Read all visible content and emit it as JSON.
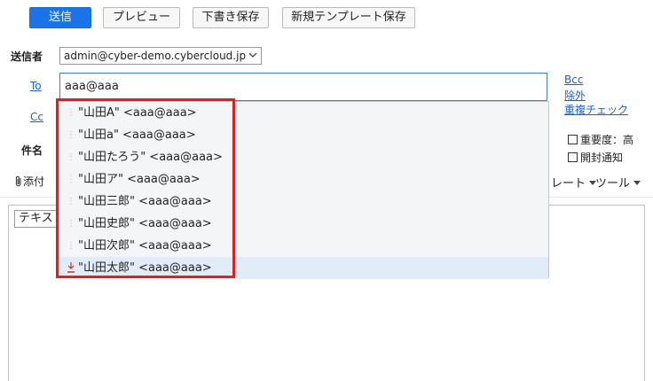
{
  "toolbar": {
    "send": "送信",
    "preview": "プレビュー",
    "save_draft": "下書き保存",
    "save_template": "新規テンプレート保存"
  },
  "sender": {
    "label": "送信者",
    "value": "admin@cyber-demo.cybercloud.jp"
  },
  "to": {
    "label": "To",
    "value": "aaa@aaa"
  },
  "cc": {
    "label": "Cc"
  },
  "subject": {
    "label": "件名"
  },
  "side_links": {
    "bcc": "Bcc",
    "exclude": "除外",
    "dup_check": "重複チェック"
  },
  "options": {
    "importance": "重要度：高",
    "read_receipt": "開封通知"
  },
  "attach": {
    "label": "添付"
  },
  "editor_toolbar": {
    "template_partial": "レート",
    "tools": "ツール",
    "format_partial": "テキス"
  },
  "suggestions": [
    "\"山田A\" <aaa@aaa>",
    "\"山田a\" <aaa@aaa>",
    "\"山田たろう\" <aaa@aaa>",
    "\"山田ア\" <aaa@aaa>",
    "\"山田三郎\" <aaa@aaa>",
    "\"山田史郎\" <aaa@aaa>",
    "\"山田次郎\" <aaa@aaa>",
    "\"山田太郎\" <aaa@aaa>"
  ],
  "highlighted_index": 7,
  "colors": {
    "primary": "#1a73e8",
    "link": "#1a5fd1",
    "highlight_box": "#e0201e",
    "suggestion_hover": "#e2ecf9"
  }
}
